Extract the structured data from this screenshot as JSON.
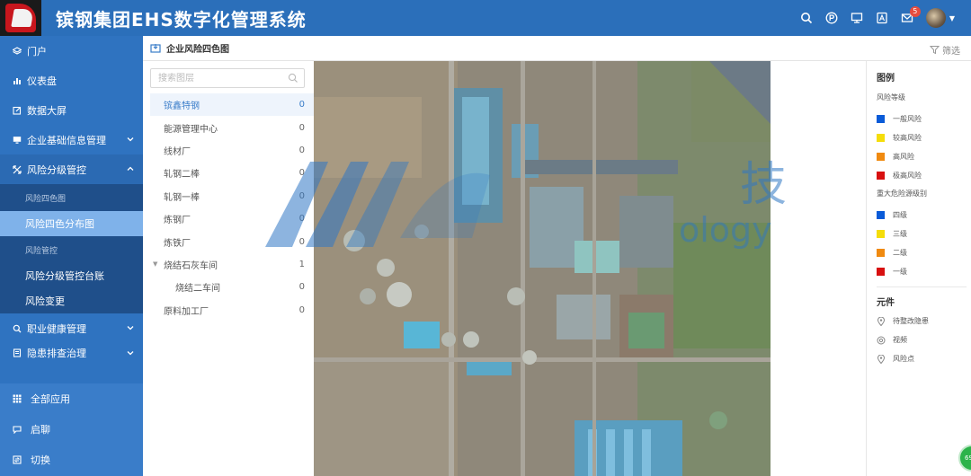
{
  "header": {
    "title": "镔钢集团EHS数字化管理系统",
    "mail_badge": "5",
    "icons": [
      "search-icon",
      "p-circle-icon",
      "monitor-icon",
      "user-card-icon",
      "mail-icon",
      "avatar",
      "caret-down-icon"
    ]
  },
  "sidebar": {
    "items": [
      {
        "label": "门户",
        "icon": "layers-icon"
      },
      {
        "label": "仪表盘",
        "icon": "bar-chart-icon"
      },
      {
        "label": "数据大屏",
        "icon": "edit-icon"
      },
      {
        "label": "企业基础信息管理",
        "icon": "desktop-icon",
        "chevron": "down"
      },
      {
        "label": "风险分级管控",
        "icon": "cross-arrows-icon",
        "chevron": "up"
      }
    ],
    "sub_items": [
      {
        "label": "风险四色图",
        "type": "group"
      },
      {
        "label": "风险四色分布图",
        "type": "item",
        "selected": true
      },
      {
        "label": "风险管控",
        "type": "group"
      },
      {
        "label": "风险分级管控台账",
        "type": "item"
      },
      {
        "label": "风险变更",
        "type": "item"
      }
    ],
    "after_items": [
      {
        "label": "职业健康管理",
        "icon": "search-icon",
        "chevron": "down"
      },
      {
        "label": "隐患排查治理",
        "icon": "document-icon",
        "chevron": "down"
      }
    ],
    "bottom": [
      {
        "label": "全部应用",
        "icon": "grid-icon"
      },
      {
        "label": "启聊",
        "icon": "chat-icon"
      },
      {
        "label": "切换",
        "icon": "switch-icon"
      }
    ]
  },
  "breadcrumb": {
    "title": "企业风险四色图",
    "filter_label": "筛选"
  },
  "tree": {
    "search_placeholder": "搜索图层",
    "rows": [
      {
        "label": "镔鑫特钢",
        "count": "0",
        "selected": true
      },
      {
        "label": "能源管理中心",
        "count": "0"
      },
      {
        "label": "线材厂",
        "count": "0"
      },
      {
        "label": "轧钢二棒",
        "count": "0"
      },
      {
        "label": "轧钢一棒",
        "count": "0"
      },
      {
        "label": "炼钢厂",
        "count": "0"
      },
      {
        "label": "炼铁厂",
        "count": "0"
      },
      {
        "label": "烧结石灰车间",
        "count": "1",
        "expandable": true
      },
      {
        "label": "烧结二车间",
        "count": "0",
        "child": true
      },
      {
        "label": "原料加工厂",
        "count": "0"
      }
    ]
  },
  "watermark": {
    "text1": "技",
    "text2": "ology"
  },
  "legend": {
    "title": "图例",
    "risk_level_title": "风险等级",
    "risk_levels": [
      {
        "label": "一般风险",
        "color": "#0a5bd8"
      },
      {
        "label": "较高风险",
        "color": "#f5dd0a"
      },
      {
        "label": "高风险",
        "color": "#f08a10"
      },
      {
        "label": "极高风险",
        "color": "#d81010"
      }
    ],
    "major_title": "重大危险源级别",
    "major_levels": [
      {
        "label": "四级",
        "color": "#0a5bd8"
      },
      {
        "label": "三级",
        "color": "#f5dd0a"
      },
      {
        "label": "二级",
        "color": "#f08a10"
      },
      {
        "label": "一级",
        "color": "#d81010"
      }
    ],
    "elements_title": "元件",
    "elements": [
      {
        "label": "待整改隐患",
        "icon": "pin-icon"
      },
      {
        "label": "视频",
        "icon": "camera-pin-icon"
      },
      {
        "label": "风险点",
        "icon": "pin-icon"
      }
    ]
  },
  "fab": {
    "label": "69"
  }
}
